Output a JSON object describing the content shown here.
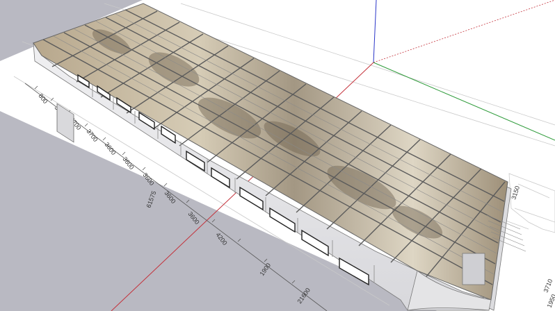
{
  "colors": {
    "sky": "#b9b9c2",
    "paper": "#ffffff",
    "roof_dark": "#8f8270",
    "roof_light": "#e6e0d2",
    "wall": "#e9e9ea",
    "axis_red": "#c4313a",
    "axis_green": "#2e9b3a",
    "axis_blue": "#2a35c8"
  },
  "drawing": {
    "dimensions": [
      "800",
      "3700",
      "3700",
      "3700",
      "3600",
      "3600",
      "3600",
      "3600",
      "3600",
      "4200",
      "1900",
      "21600",
      "61575",
      "3150",
      "3710",
      "1950"
    ]
  }
}
